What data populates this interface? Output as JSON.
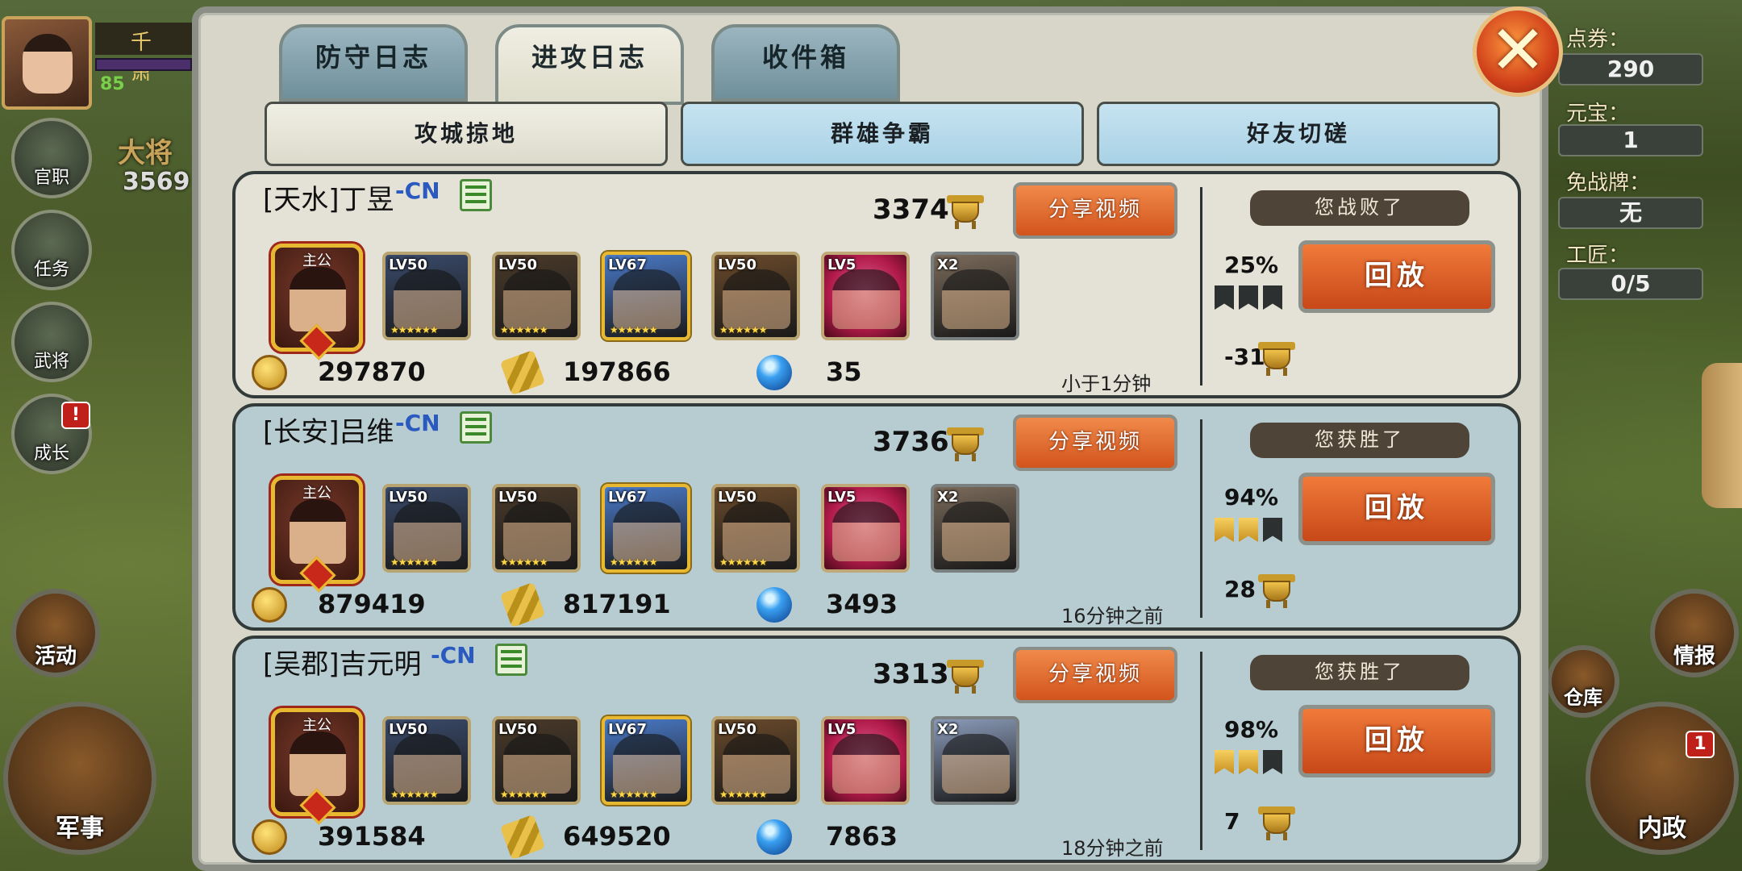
{
  "hud": {
    "player_name": "千萧",
    "level": "85",
    "general_title": "大将",
    "power": "3569",
    "left_buttons": [
      "官职",
      "任务",
      "武将",
      "成长"
    ],
    "growth_badge": "!",
    "event_label": "活动",
    "military_label": "军事",
    "right_resources": [
      {
        "label": "点券：",
        "value": "290"
      },
      {
        "label": "元宝：",
        "value": "1"
      },
      {
        "label": "免战牌：",
        "value": "无"
      },
      {
        "label": "工匠：",
        "value": "0/5"
      }
    ],
    "intel_label": "情报",
    "warehouse_label": "仓库",
    "domestic_label": "内政",
    "domestic_badge": "1"
  },
  "tabs": [
    {
      "label": "防守日志",
      "active": false
    },
    {
      "label": "进攻日志",
      "active": true
    },
    {
      "label": "收件箱",
      "active": false
    }
  ],
  "close_label": "✕",
  "subtabs": [
    {
      "label": "攻城掠地",
      "selected": true
    },
    {
      "label": "群雄争霸",
      "selected": false
    },
    {
      "label": "好友切磋",
      "selected": false
    }
  ],
  "common": {
    "lord_label": "主公",
    "share_label": "分享视频",
    "replay_label": "回放",
    "cn_tag": "-CN",
    "stars": "★★★★★★"
  },
  "rows": [
    {
      "title": "[天水]丁昱",
      "power": "3374",
      "result": "您战败了",
      "outcome": "lose",
      "percent": "25%",
      "flags": [
        false,
        false,
        false
      ],
      "delta": "-31",
      "time": "小于1分钟",
      "gold": "297870",
      "food": "197866",
      "gems": "35",
      "cards": [
        {
          "lv": "LV50",
          "style": "normal",
          "hue": "#3a4a6a"
        },
        {
          "lv": "LV50",
          "style": "normal",
          "hue": "#4a3a2a"
        },
        {
          "lv": "LV67",
          "style": "gold",
          "hue": "#4a7ac8"
        },
        {
          "lv": "LV50",
          "style": "normal",
          "hue": "#6a4a2a"
        },
        {
          "lv": "LV5",
          "style": "pink",
          "hue": "#b01a4a"
        },
        {
          "lv": "X2",
          "style": "x2",
          "hue": "#7a6a5a"
        }
      ]
    },
    {
      "title": "[长安]吕维",
      "power": "3736",
      "result": "您获胜了",
      "outcome": "win",
      "percent": "94%",
      "flags": [
        true,
        true,
        false
      ],
      "delta": "28",
      "time": "16分钟之前",
      "gold": "879419",
      "food": "817191",
      "gems": "3493",
      "cards": [
        {
          "lv": "LV50",
          "style": "normal",
          "hue": "#3a4a6a"
        },
        {
          "lv": "LV50",
          "style": "normal",
          "hue": "#4a3a2a"
        },
        {
          "lv": "LV67",
          "style": "gold",
          "hue": "#4a7ac8"
        },
        {
          "lv": "LV50",
          "style": "normal",
          "hue": "#6a4a2a"
        },
        {
          "lv": "LV5",
          "style": "pink",
          "hue": "#b01a4a"
        },
        {
          "lv": "X2",
          "style": "x2",
          "hue": "#7a6a5a"
        }
      ]
    },
    {
      "title": "[吴郡]吉元明",
      "power": "3313",
      "result": "您获胜了",
      "outcome": "win",
      "percent": "98%",
      "flags": [
        true,
        true,
        false
      ],
      "delta": "7",
      "time": "18分钟之前",
      "gold": "391584",
      "food": "649520",
      "gems": "7863",
      "cards": [
        {
          "lv": "LV50",
          "style": "normal",
          "hue": "#3a4a6a"
        },
        {
          "lv": "LV50",
          "style": "normal",
          "hue": "#4a3a2a"
        },
        {
          "lv": "LV67",
          "style": "gold",
          "hue": "#4a7ac8"
        },
        {
          "lv": "LV50",
          "style": "normal",
          "hue": "#6a4a2a"
        },
        {
          "lv": "LV5",
          "style": "pink",
          "hue": "#b01a4a"
        },
        {
          "lv": "X2",
          "style": "x2",
          "hue": "#8a9ab8"
        }
      ]
    }
  ]
}
